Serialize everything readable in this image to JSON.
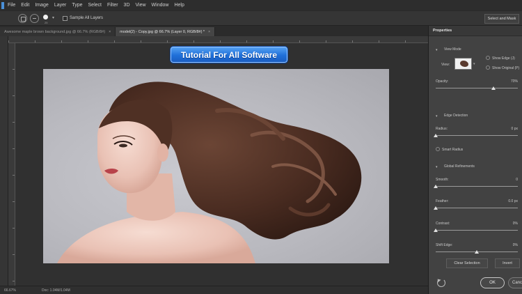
{
  "menu": {
    "items": [
      "File",
      "Edit",
      "Image",
      "Layer",
      "Type",
      "Select",
      "Filter",
      "3D",
      "View",
      "Window",
      "Help"
    ]
  },
  "options": {
    "brush_size": "25",
    "sample_all_layers": "Sample All Layers",
    "select_and_mask": "Select and Mask"
  },
  "tabs": [
    {
      "label": "Awesome maple brown background.jpg @ 66.7% (RGB/8#)",
      "close": "×"
    },
    {
      "label": "model(2) - Copy.jpg @ 66.7% (Layer 0, RGB/8#) *",
      "close": "×"
    }
  ],
  "watermark": "Tutorial For All Software",
  "status": {
    "zoom": "66.67%",
    "doc": "Doc: 1.04M/1.04M"
  },
  "properties": {
    "title": "Properties",
    "view_mode": "View Mode",
    "view_label": "View:",
    "show_edge": "Show Edge (J)",
    "show_original": "Show Original (P)",
    "opacity_label": "Opacity:",
    "opacity_value": "70%",
    "opacity_level": 0.7,
    "edge_detection": "Edge Detection",
    "radius_label": "Radius:",
    "radius_value": "0 px",
    "radius_level": 0.0,
    "smart_radius": "Smart Radius",
    "global_refinements": "Global Refinements",
    "smooth_label": "Smooth:",
    "smooth_value": "0",
    "smooth_level": 0.0,
    "feather_label": "Feather:",
    "feather_value": "0.0 px",
    "feather_level": 0.0,
    "contrast_label": "Contrast:",
    "contrast_value": "0%",
    "contrast_level": 0.0,
    "shift_edge_label": "Shift Edge:",
    "shift_edge_value": "0%",
    "shift_edge_level": 0.5,
    "clear_selection": "Clear Selection",
    "invert": "Invert",
    "ok": "OK",
    "cancel": "Cancel"
  }
}
